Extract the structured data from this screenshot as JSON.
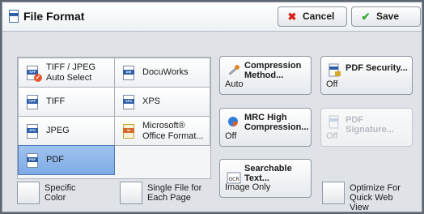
{
  "header": {
    "title": "File Format",
    "cancel_label": "Cancel",
    "save_label": "Save"
  },
  "formats": [
    {
      "label_l1": "TIFF / JPEG",
      "label_l2": "Auto Select",
      "icon": "tiff-jpeg-icon"
    },
    {
      "label_l1": "DocuWorks",
      "label_l2": "",
      "icon": "docuworks-icon"
    },
    {
      "label_l1": "TIFF",
      "label_l2": "",
      "icon": "tiff-icon"
    },
    {
      "label_l1": "XPS",
      "label_l2": "",
      "icon": "xps-icon"
    },
    {
      "label_l1": "JPEG",
      "label_l2": "",
      "icon": "jpeg-icon"
    },
    {
      "label_l1": "Microsoft®",
      "label_l2": "Office Format...",
      "icon": "office-icon"
    },
    {
      "label_l1": "PDF",
      "label_l2": "",
      "icon": "pdf-icon",
      "selected": true
    }
  ],
  "options": {
    "compression": {
      "title_l1": "Compression",
      "title_l2": "Method...",
      "value": "Auto"
    },
    "pdf_security": {
      "title_l1": "PDF Security...",
      "title_l2": "",
      "value": "Off"
    },
    "mrc": {
      "title_l1": "MRC High",
      "title_l2": "Compression...",
      "value": "Off"
    },
    "pdf_signature": {
      "title_l1": "PDF Signature...",
      "title_l2": "",
      "value": "Off"
    },
    "searchable": {
      "title_l1": "Searchable",
      "title_l2": "Text...",
      "value": "Image Only"
    }
  },
  "checkboxes": {
    "specific_color": {
      "l1": "Specific",
      "l2": "Color"
    },
    "single_file": {
      "l1": "Single File for",
      "l2": "Each Page"
    },
    "optimize": {
      "l1": "Optimize For",
      "l2": "Quick Web View"
    }
  },
  "colors": {
    "accent": "#2f5fa8",
    "selected": "#8fb8ea",
    "cancel": "#d91e18",
    "save": "#3aa52f"
  }
}
